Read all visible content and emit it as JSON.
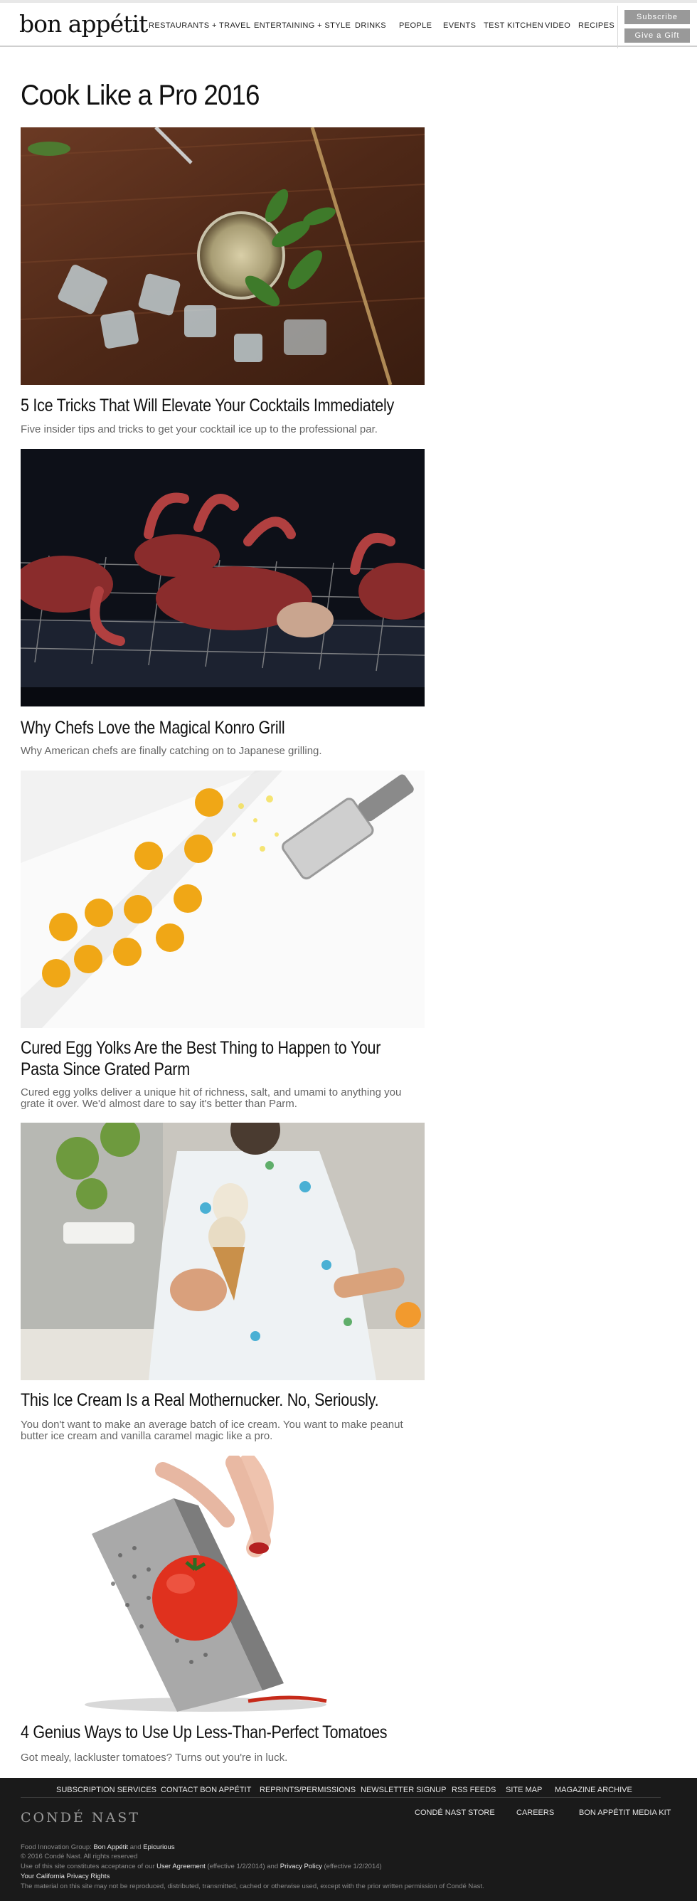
{
  "header": {
    "logo": "bon appétit",
    "nav": [
      "RESTAURANTS + TRAVEL",
      "ENTERTAINING + STYLE",
      "DRINKS",
      "PEOPLE",
      "EVENTS",
      "TEST KITCHEN",
      "VIDEO",
      "RECIPES"
    ],
    "subscribe_label": "Subscribe",
    "gift_label": "Give a Gift"
  },
  "page": {
    "title": "Cook Like a Pro 2016"
  },
  "articles": [
    {
      "title": "5 Ice Tricks That Will Elevate Your Cocktails Immediately",
      "desc": "Five insider tips and tricks to get your cocktail ice up to the professional par.",
      "image": "cocktail-with-ice-photo"
    },
    {
      "title": "Why Chefs Love the Magical Konro Grill",
      "desc": "Why American chefs are finally catching on to Japanese grilling.",
      "image": "grilled-octopus-photo"
    },
    {
      "title_line1": "Cured Egg Yolks Are the Best Thing to Happen to Your",
      "title_line2": "Pasta Since Grated Parm",
      "desc_line1": "Cured egg yolks deliver a unique hit of richness, salt, and umami to anything you",
      "desc_line2": "grate it over. We'd almost dare to say it's better than Parm.",
      "image": "cured-egg-yolks-photo"
    },
    {
      "title": "This Ice Cream Is a Real Mothernucker. No, Seriously.",
      "desc_line1": "You don't want to make an average batch of ice cream. You want to make peanut",
      "desc_line2": "butter ice cream and vanilla caramel magic like a pro.",
      "image": "ice-cream-cone-photo"
    },
    {
      "title": "4 Genius Ways to Use Up Less-Than-Perfect Tomatoes",
      "desc": "Got mealy, lackluster tomatoes? Turns out you're in luck.",
      "image": "tomato-grater-photo"
    }
  ],
  "footer": {
    "links_row1": [
      "SUBSCRIPTION SERVICES",
      "CONTACT BON APPÉTIT",
      "REPRINTS/PERMISSIONS",
      "NEWSLETTER SIGNUP",
      "RSS FEEDS",
      "SITE MAP",
      "MAGAZINE ARCHIVE"
    ],
    "links_row2": [
      "CONDÉ NAST STORE",
      "CAREERS",
      "BON APPÉTIT MEDIA KIT"
    ],
    "brand": "CONDÉ NAST",
    "group_prefix": "Food Innovation Group:",
    "group_link1": "Bon Appétit",
    "group_and": "and",
    "group_link2": "Epicurious",
    "copyright": "© 2016 Condé Nast. All rights reserved",
    "use_prefix": "Use of this site constitutes acceptance of our",
    "user_agreement": "User Agreement",
    "ua_effective": "(effective 1/2/2014) and",
    "privacy_policy": "Privacy Policy",
    "pp_effective": "(effective 1/2/2014)",
    "california": "Your California Privacy Rights",
    "material": "The material on this site may not be reproduced, distributed, transmitted, cached or otherwise used, except with the prior written permission of Condé Nast."
  }
}
